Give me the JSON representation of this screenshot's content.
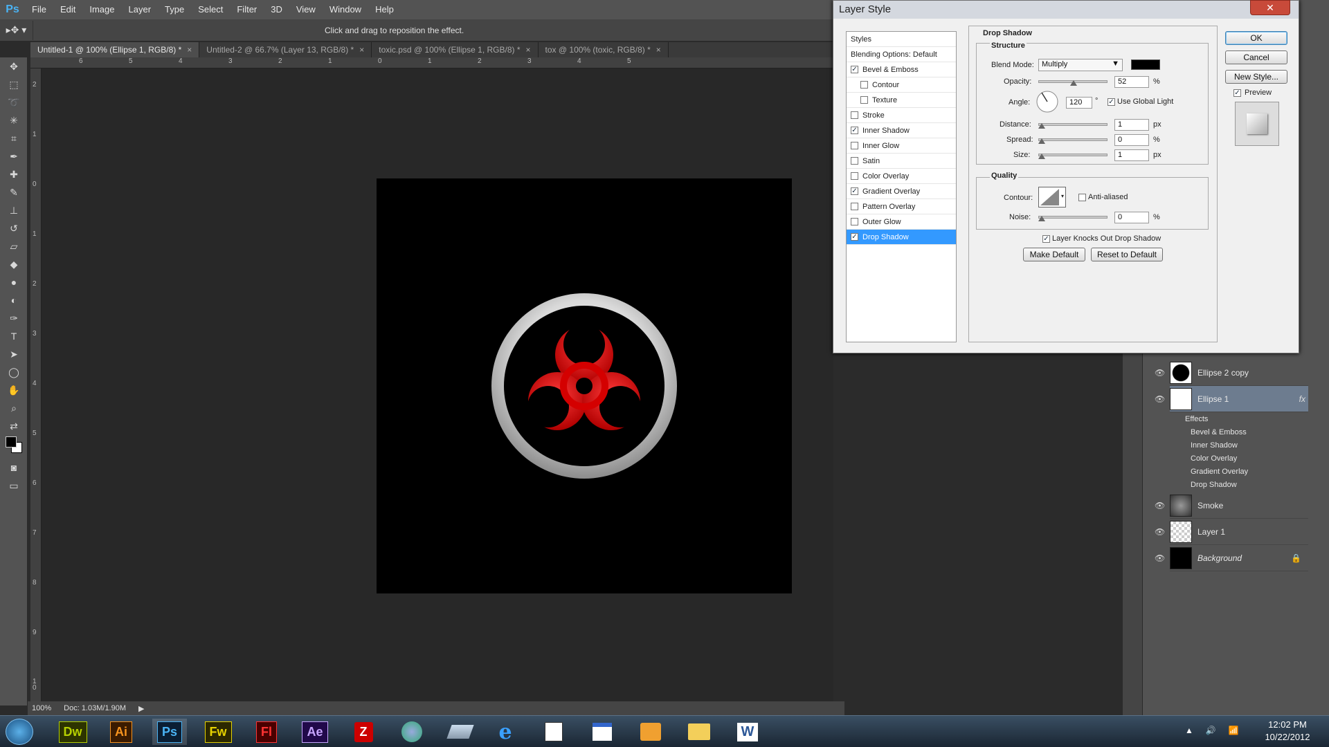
{
  "menubar": {
    "logo": "Ps",
    "items": [
      "File",
      "Edit",
      "Image",
      "Layer",
      "Type",
      "Select",
      "Filter",
      "3D",
      "View",
      "Window",
      "Help"
    ]
  },
  "options": {
    "hint": "Click and drag to reposition the effect."
  },
  "tabs": [
    {
      "label": "Untitled-1 @ 100% (Ellipse 1, RGB/8) *",
      "active": true
    },
    {
      "label": "Untitled-2 @ 66.7% (Layer 13, RGB/8) *",
      "active": false
    },
    {
      "label": "toxic.psd @ 100% (Ellipse 1, RGB/8) *",
      "active": false
    },
    {
      "label": "tox @ 100% (toxic, RGB/8) *",
      "active": false
    }
  ],
  "tab_close": "×",
  "ruler": {
    "top": [
      "6",
      "5",
      "4",
      "3",
      "2",
      "1",
      "0",
      "1",
      "2",
      "3",
      "4",
      "5"
    ],
    "left": [
      "2",
      "1",
      "0",
      "1",
      "2",
      "3",
      "4",
      "5",
      "6",
      "7",
      "8",
      "9",
      "1 0"
    ]
  },
  "status": {
    "zoom": "100%",
    "doc": "Doc: 1.03M/1.90M"
  },
  "dialog": {
    "title": "Layer Style",
    "close": "✕",
    "styles_header": "Styles",
    "blending": "Blending Options: Default",
    "styles": [
      {
        "label": "Bevel & Emboss",
        "checked": true,
        "indent": false
      },
      {
        "label": "Contour",
        "checked": false,
        "indent": true
      },
      {
        "label": "Texture",
        "checked": false,
        "indent": true
      },
      {
        "label": "Stroke",
        "checked": false,
        "indent": false
      },
      {
        "label": "Inner Shadow",
        "checked": true,
        "indent": false
      },
      {
        "label": "Inner Glow",
        "checked": false,
        "indent": false
      },
      {
        "label": "Satin",
        "checked": false,
        "indent": false
      },
      {
        "label": "Color Overlay",
        "checked": false,
        "indent": false
      },
      {
        "label": "Gradient Overlay",
        "checked": true,
        "indent": false
      },
      {
        "label": "Pattern Overlay",
        "checked": false,
        "indent": false
      },
      {
        "label": "Outer Glow",
        "checked": false,
        "indent": false
      },
      {
        "label": "Drop Shadow",
        "checked": true,
        "indent": false,
        "selected": true
      }
    ],
    "section_title": "Drop Shadow",
    "structure": "Structure",
    "blend_mode_label": "Blend Mode:",
    "blend_mode": "Multiply",
    "opacity_label": "Opacity:",
    "opacity": "52",
    "angle_label": "Angle:",
    "angle": "120",
    "deg": "°",
    "global_light": "Use Global Light",
    "distance_label": "Distance:",
    "distance": "1",
    "spread_label": "Spread:",
    "spread": "0",
    "size_label": "Size:",
    "size": "1",
    "px": "px",
    "pct": "%",
    "quality": "Quality",
    "contour_label": "Contour:",
    "anti_aliased": "Anti-aliased",
    "noise_label": "Noise:",
    "noise": "0",
    "knockout": "Layer Knocks Out Drop Shadow",
    "make_default": "Make Default",
    "reset_default": "Reset to Default",
    "ok": "OK",
    "cancel": "Cancel",
    "new_style": "New Style...",
    "preview": "Preview",
    "check": "✓"
  },
  "layers": [
    {
      "name": "Ellipse 2 copy",
      "selected": false
    },
    {
      "name": "Ellipse 1",
      "selected": true,
      "fx": "fx"
    },
    {
      "name": "Smoke",
      "selected": false
    },
    {
      "name": "Layer 1",
      "selected": false
    },
    {
      "name": "Background",
      "selected": false
    }
  ],
  "effects": [
    "Effects",
    "Bevel & Emboss",
    "Inner Shadow",
    "Color Overlay",
    "Gradient Overlay",
    "Drop Shadow"
  ],
  "taskbar": {
    "apps": [
      {
        "label": "Dw",
        "color": "#b6d000",
        "bg": "#2d3400"
      },
      {
        "label": "Ai",
        "color": "#f7931e",
        "bg": "#3b1b00"
      },
      {
        "label": "Ps",
        "color": "#4ab3f4",
        "bg": "#0b1e33"
      },
      {
        "label": "Fw",
        "color": "#e6d200",
        "bg": "#2c2800"
      },
      {
        "label": "Fl",
        "color": "#ff3333",
        "bg": "#4a0000"
      },
      {
        "label": "Ae",
        "color": "#c7a5ff",
        "bg": "#21094a"
      }
    ],
    "time": "12:02 PM",
    "date": "10/22/2012"
  }
}
